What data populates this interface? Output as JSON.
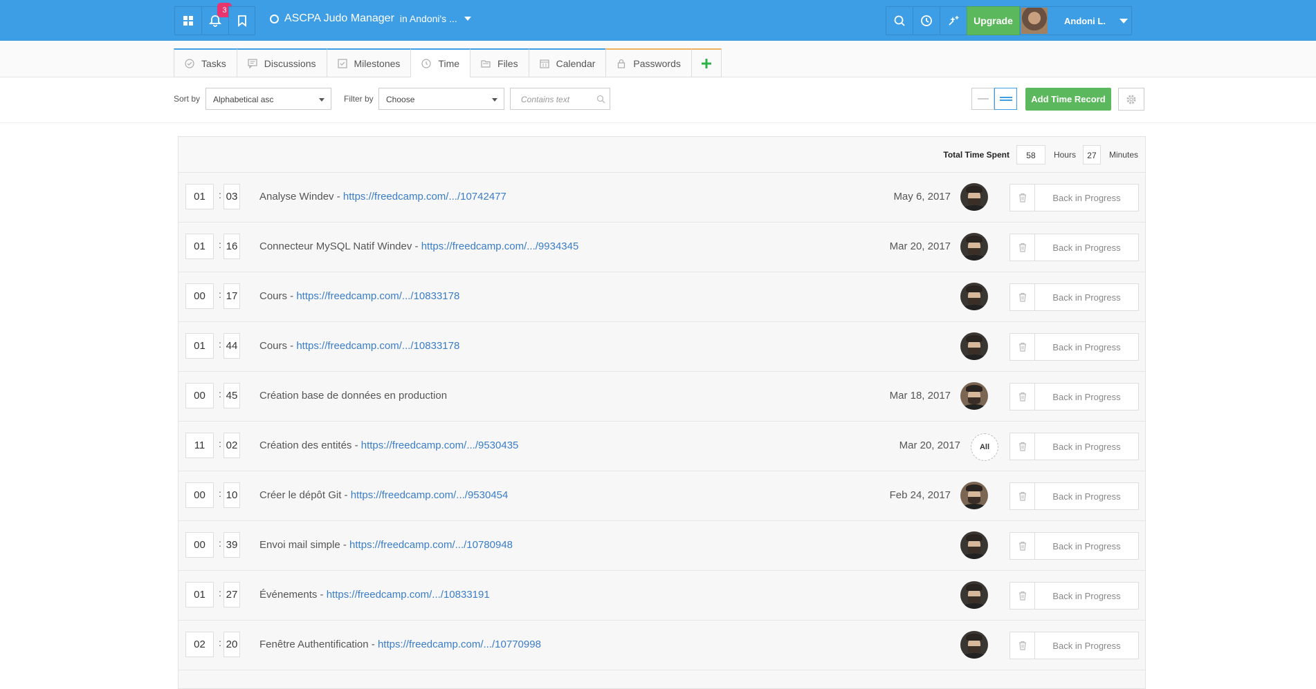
{
  "topbar": {
    "notifications_count": "3",
    "project_name": "ASCPA Judo Manager",
    "project_sub": "in Andoni's ...",
    "upgrade_label": "Upgrade",
    "user_name": "Andoni L."
  },
  "tabs": [
    {
      "label": "Tasks",
      "icon": "check-circle-icon"
    },
    {
      "label": "Discussions",
      "icon": "chat-icon"
    },
    {
      "label": "Milestones",
      "icon": "milestone-icon"
    },
    {
      "label": "Time",
      "icon": "clock-icon"
    },
    {
      "label": "Files",
      "icon": "folder-icon"
    },
    {
      "label": "Calendar",
      "icon": "calendar-icon"
    },
    {
      "label": "Passwords",
      "icon": "lock-icon"
    }
  ],
  "filters": {
    "sort_label": "Sort by",
    "sort_value": "Alphabetical asc",
    "filter_label": "Filter by",
    "filter_value": "Choose",
    "search_placeholder": "Contains text",
    "add_label": "Add Time Record"
  },
  "summary": {
    "label": "Total Time Spent",
    "hours": "58",
    "hours_unit": "Hours",
    "minutes": "27",
    "minutes_unit": "Minutes"
  },
  "records": [
    {
      "h": "01",
      "m": "03",
      "title": "Analyse Windev - ",
      "link": "https://freedcamp.com/.../10742477",
      "date": "May 6, 2017",
      "assignee": "avatar-dark",
      "action": "Back in Progress"
    },
    {
      "h": "01",
      "m": "16",
      "title": "Connecteur MySQL Natif Windev - ",
      "link": "https://freedcamp.com/.../9934345",
      "date": "Mar 20, 2017",
      "assignee": "avatar-dark",
      "action": "Back in Progress"
    },
    {
      "h": "00",
      "m": "17",
      "title": "Cours - ",
      "link": "https://freedcamp.com/.../10833178",
      "date": "",
      "assignee": "avatar-dark",
      "action": "Back in Progress"
    },
    {
      "h": "01",
      "m": "44",
      "title": "Cours - ",
      "link": "https://freedcamp.com/.../10833178",
      "date": "",
      "assignee": "avatar-dark",
      "action": "Back in Progress"
    },
    {
      "h": "00",
      "m": "45",
      "title": "Création base de données en production",
      "link": "",
      "date": "Mar 18, 2017",
      "assignee": "avatar-light",
      "action": "Back in Progress"
    },
    {
      "h": "11",
      "m": "02",
      "title": "Création des entités - ",
      "link": "https://freedcamp.com/.../9530435",
      "date": "Mar 20, 2017",
      "assignee": "all",
      "all_label": "All",
      "action": "Back in Progress"
    },
    {
      "h": "00",
      "m": "10",
      "title": "Créer le dépôt Git - ",
      "link": "https://freedcamp.com/.../9530454",
      "date": "Feb 24, 2017",
      "assignee": "avatar-light",
      "action": "Back in Progress"
    },
    {
      "h": "00",
      "m": "39",
      "title": "Envoi mail simple - ",
      "link": "https://freedcamp.com/.../10780948",
      "date": "",
      "assignee": "avatar-dark",
      "action": "Back in Progress"
    },
    {
      "h": "01",
      "m": "27",
      "title": "Événements - ",
      "link": "https://freedcamp.com/.../10833191",
      "date": "",
      "assignee": "avatar-dark",
      "action": "Back in Progress"
    },
    {
      "h": "02",
      "m": "20",
      "title": "Fenêtre Authentification - ",
      "link": "https://freedcamp.com/.../10770998",
      "date": "",
      "assignee": "avatar-dark",
      "action": "Back in Progress"
    }
  ],
  "colors": {
    "topbar": "#3d9ee5",
    "accent_green": "#5cb85c",
    "badge": "#e8356d",
    "link": "#3a7dc8"
  }
}
